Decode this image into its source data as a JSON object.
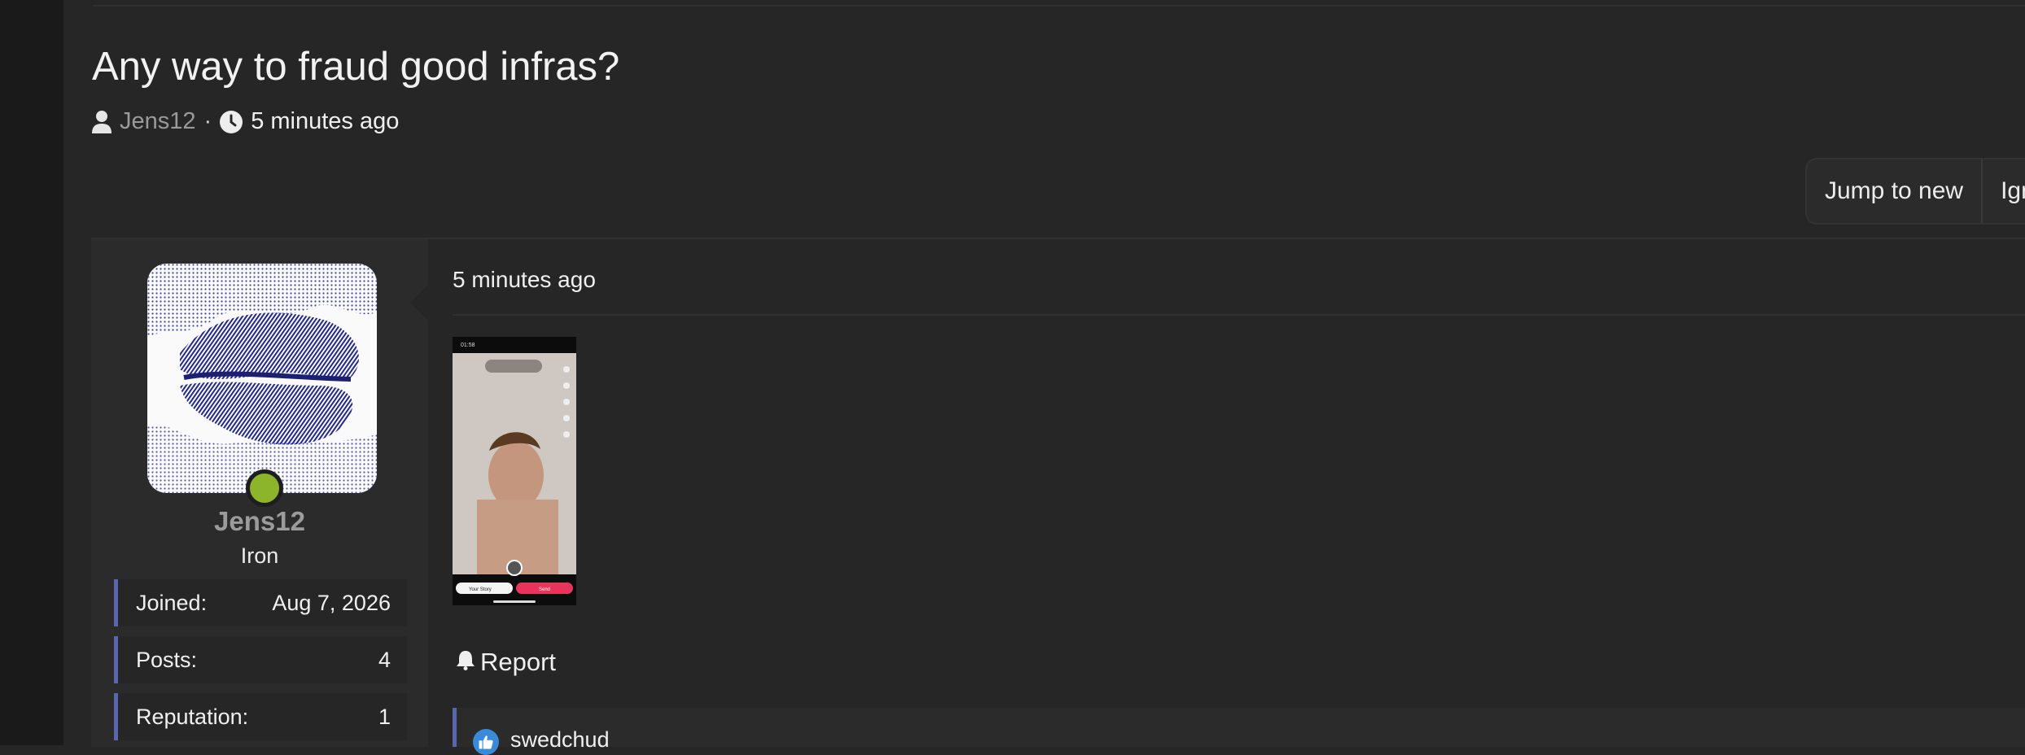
{
  "thread": {
    "title": "Any way to fraud good infras?",
    "author": "Jens12",
    "separator": "·",
    "time": "5 minutes ago"
  },
  "actions": {
    "jump_to_new": "Jump to new",
    "ignore": "Ign"
  },
  "post": {
    "time": "5 minutes ago",
    "report": "Report",
    "like_plus": "+",
    "reaction_user": "swedchud"
  },
  "user": {
    "name": "Jens12",
    "rank": "Iron",
    "online": true,
    "stats": [
      {
        "label": "Joined:",
        "value": "Aug 7, 2026"
      },
      {
        "label": "Posts:",
        "value": "4"
      },
      {
        "label": "Reputation:",
        "value": "1"
      }
    ]
  },
  "attachment": {
    "status_time": "01:58",
    "story_button": "Your Story",
    "send_button": "Send"
  },
  "colors": {
    "background": "#262626",
    "accent_border": "#5865b0",
    "online": "#8db52c",
    "send_button": "#e8335a"
  }
}
